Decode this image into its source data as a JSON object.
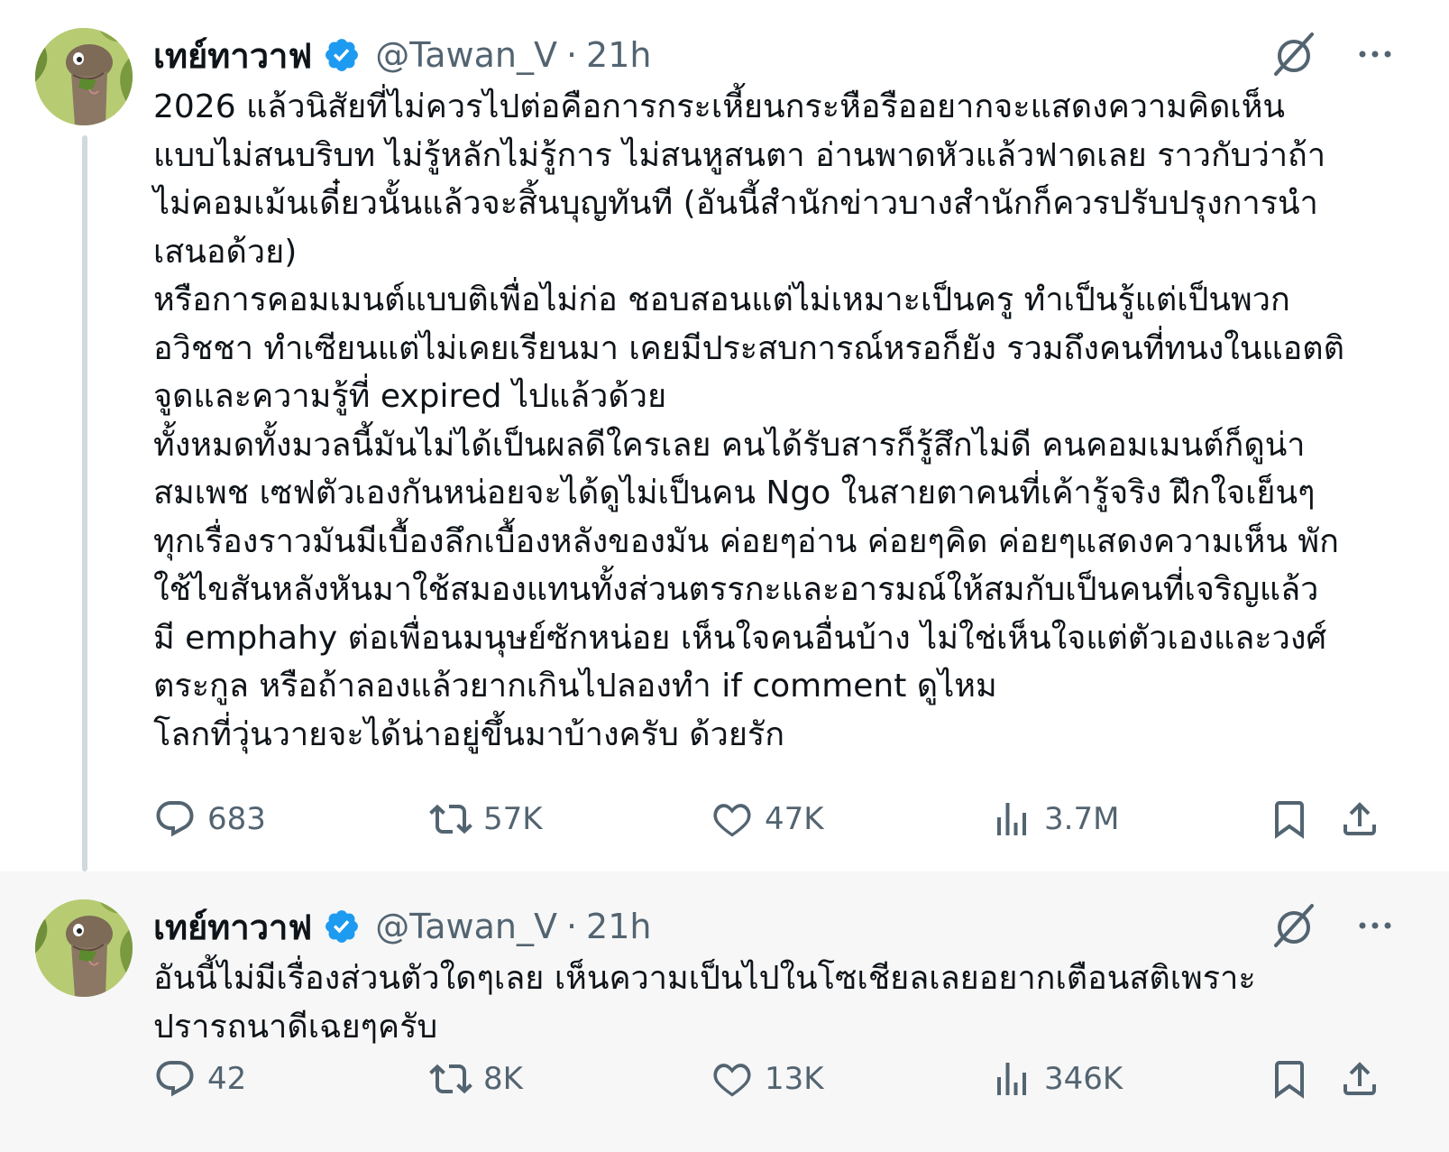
{
  "tweets": [
    {
      "display_name": "เทย์ทาวาฟ",
      "handle": "@Tawan_V",
      "separator": "·",
      "time": "21h",
      "text": "2026 แล้วนิสัยที่ไม่ควรไปต่อคือการกระเหี้ยนกระหือรืออยากจะแสดงความคิดเห็น\nแบบไม่สนบริบท ไม่รู้หลักไม่รู้การ ไม่สนหูสนตา อ่านพาดหัวแล้วฟาดเลย ราวกับว่าถ้า\nไม่คอมเม้นเดี๋ยวนั้นแล้วจะสิ้นบุญทันที (อันนี้สำนักข่าวบางสำนักก็ควรปรับปรุงการนำ\nเสนอด้วย)\n หรือการคอมเมนต์แบบติเพื่อไม่ก่อ ชอบสอนแต่ไม่เหมาะเป็นครู ทำเป็นรู้แต่เป็นพวก\nอวิชชา ทำเซียนแต่ไม่เคยเรียนมา เคยมีประสบการณ์หรอก็ยัง รวมถึงคนที่ทนงในแอตติ\nจูดและความรู้ที่ expired ไปแล้วด้วย\n ทั้งหมดทั้งมวลนี้มันไม่ได้เป็นผลดีใครเลย คนได้รับสารก็รู้สึกไม่ดี คนคอมเมนต์ก็ดูน่า\nสมเพช เซฟตัวเองกันหน่อยจะได้ดูไม่เป็นคน Ngo ในสายตาคนที่เค้ารู้จริง ฝึกใจเย็นๆ\nทุกเรื่องราวมันมีเบื้องลึกเบื้องหลังของมัน ค่อยๆอ่าน ค่อยๆคิด ค่อยๆแสดงความเห็น พัก\nใช้ไขสันหลังหันมาใช้สมองแทนทั้งส่วนตรรกะและอารมณ์ให้สมกับเป็นคนที่เจริญแล้ว\nมี emphahy ต่อเพื่อนมนุษย์ซักหน่อย เห็นใจคนอื่นบ้าง ไม่ใช่เห็นใจแต่ตัวเองและวงศ์\nตระกูล หรือถ้าลองแล้วยากเกินไปลองทำ if comment ดูไหม\nโลกที่วุ่นวายจะได้น่าอยู่ขึ้นมาบ้างครับ ด้วยรัก",
      "replies": "683",
      "reposts": "57K",
      "likes": "47K",
      "views": "3.7M"
    },
    {
      "display_name": "เทย์ทาวาฟ",
      "handle": "@Tawan_V",
      "separator": "·",
      "time": "21h",
      "text": "อันนี้ไม่มีเรื่องส่วนตัวใดๆเลย เห็นความเป็นไปในโซเชียลเลยอยากเตือนสติเพราะ\nปรารถนาดีเฉยๆครับ",
      "replies": "42",
      "reposts": "8K",
      "likes": "13K",
      "views": "346K"
    }
  ],
  "icons": {
    "verified": "verified-badge-icon",
    "grok": "grok-icon",
    "more": "more-icon",
    "reply": "reply-icon",
    "repost": "repost-icon",
    "like": "like-icon",
    "views": "views-icon",
    "bookmark": "bookmark-icon",
    "share": "share-icon"
  },
  "colors": {
    "verified_blue": "#1d9bf0",
    "secondary_text": "#536471",
    "thread_line": "#cfd9de",
    "reply_background": "#f7f7f7"
  }
}
